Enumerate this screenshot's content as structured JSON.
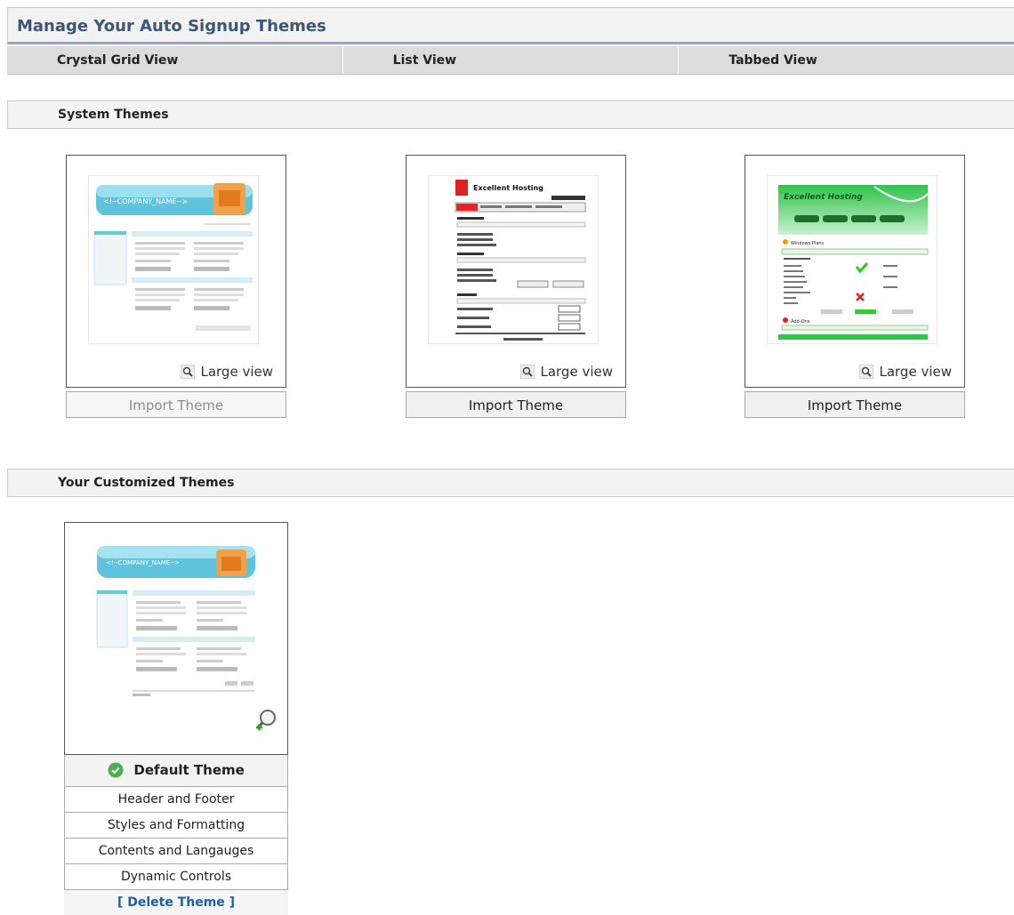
{
  "page": {
    "title": "Manage Your Auto Signup Themes"
  },
  "views": [
    {
      "label": "Crystal Grid View"
    },
    {
      "label": "List View"
    },
    {
      "label": "Tabbed View"
    }
  ],
  "system_themes": {
    "heading": "System Themes",
    "cards": [
      {
        "large_view": "Large view",
        "import": "Import Theme",
        "import_enabled": false,
        "preview_text": [
          "<!--COMPANY_NAME-->"
        ]
      },
      {
        "large_view": "Large view",
        "import": "Import Theme",
        "import_enabled": true,
        "preview_text": [
          "Excellent Hosting"
        ]
      },
      {
        "large_view": "Large view",
        "import": "Import Theme",
        "import_enabled": true,
        "preview_text": [
          "Excellent Hosting",
          "Windows Plans",
          "Add-Ons"
        ]
      }
    ]
  },
  "custom_themes": {
    "heading": "Your Customized Themes",
    "cards": [
      {
        "preview_text": [
          "<!--COMPANY_NAME-->"
        ],
        "default_label": "Default Theme",
        "menu": [
          "Header and Footer",
          "Styles and Formatting",
          "Contents and Langauges",
          "Dynamic Controls"
        ],
        "delete": "[ Delete Theme ]"
      }
    ]
  },
  "colors": {
    "accent": "#8fa3dc",
    "title": "#3e5577",
    "link": "#1d5fa8",
    "check": "#4caf50"
  }
}
